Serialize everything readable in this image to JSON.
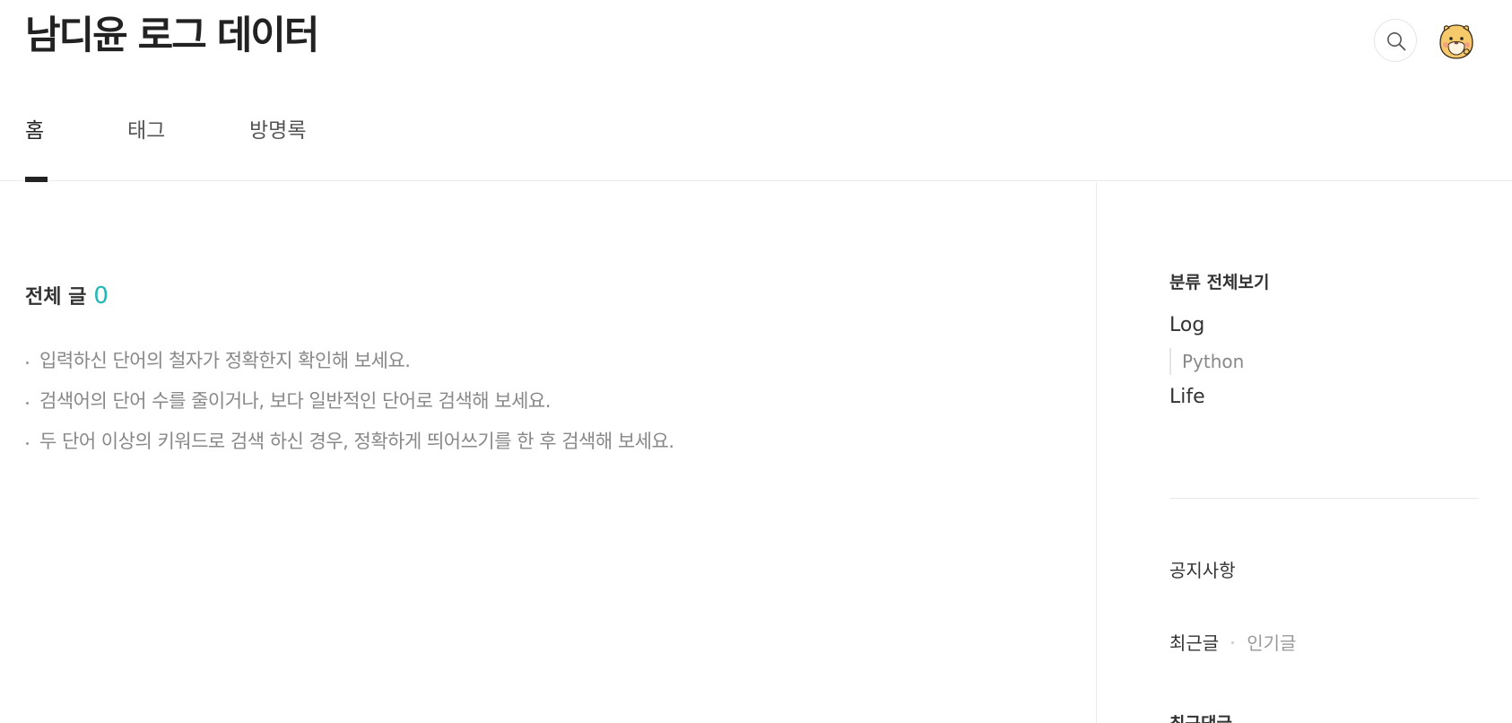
{
  "header": {
    "blog_title": "남디윤 로그 데이터"
  },
  "nav": {
    "items": [
      {
        "label": "홈",
        "active": true
      },
      {
        "label": "태그",
        "active": false
      },
      {
        "label": "방명록",
        "active": false
      }
    ]
  },
  "icons": {
    "search": "search-icon",
    "avatar": "hamster-avatar"
  },
  "main": {
    "total_label": "전체 글",
    "total_count": "0",
    "tips": [
      "입력하신 단어의 철자가 정확한지 확인해 보세요.",
      "검색어의 단어 수를 줄이거나, 보다 일반적인 단어로 검색해 보세요.",
      "두 단어 이상의 키워드로 검색 하신 경우, 정확하게 띄어쓰기를 한 후 검색해 보세요."
    ]
  },
  "sidebar": {
    "category_heading": "분류 전체보기",
    "categories": [
      {
        "label": "Log",
        "children": [
          "Python"
        ]
      },
      {
        "label": "Life",
        "children": []
      }
    ],
    "notice_label": "공지사항",
    "post_tabs": [
      "최근글",
      "인기글"
    ],
    "cut_heading": "최근댓글"
  },
  "colors": {
    "accent": "#1fb8b6",
    "text": "#222222",
    "muted": "#888888",
    "border": "#ebebeb"
  }
}
